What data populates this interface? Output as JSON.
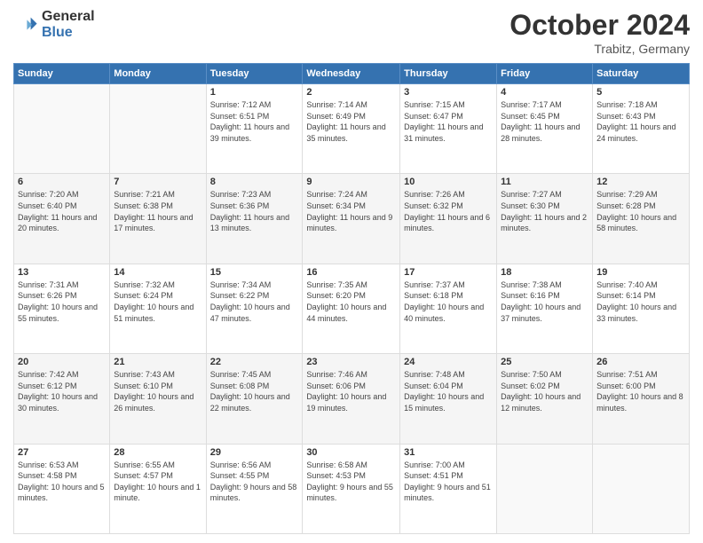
{
  "logo": {
    "line1": "General",
    "line2": "Blue"
  },
  "title": "October 2024",
  "subtitle": "Trabitz, Germany",
  "weekdays": [
    "Sunday",
    "Monday",
    "Tuesday",
    "Wednesday",
    "Thursday",
    "Friday",
    "Saturday"
  ],
  "weeks": [
    [
      {
        "day": "",
        "info": ""
      },
      {
        "day": "",
        "info": ""
      },
      {
        "day": "1",
        "info": "Sunrise: 7:12 AM\nSunset: 6:51 PM\nDaylight: 11 hours and 39 minutes."
      },
      {
        "day": "2",
        "info": "Sunrise: 7:14 AM\nSunset: 6:49 PM\nDaylight: 11 hours and 35 minutes."
      },
      {
        "day": "3",
        "info": "Sunrise: 7:15 AM\nSunset: 6:47 PM\nDaylight: 11 hours and 31 minutes."
      },
      {
        "day": "4",
        "info": "Sunrise: 7:17 AM\nSunset: 6:45 PM\nDaylight: 11 hours and 28 minutes."
      },
      {
        "day": "5",
        "info": "Sunrise: 7:18 AM\nSunset: 6:43 PM\nDaylight: 11 hours and 24 minutes."
      }
    ],
    [
      {
        "day": "6",
        "info": "Sunrise: 7:20 AM\nSunset: 6:40 PM\nDaylight: 11 hours and 20 minutes."
      },
      {
        "day": "7",
        "info": "Sunrise: 7:21 AM\nSunset: 6:38 PM\nDaylight: 11 hours and 17 minutes."
      },
      {
        "day": "8",
        "info": "Sunrise: 7:23 AM\nSunset: 6:36 PM\nDaylight: 11 hours and 13 minutes."
      },
      {
        "day": "9",
        "info": "Sunrise: 7:24 AM\nSunset: 6:34 PM\nDaylight: 11 hours and 9 minutes."
      },
      {
        "day": "10",
        "info": "Sunrise: 7:26 AM\nSunset: 6:32 PM\nDaylight: 11 hours and 6 minutes."
      },
      {
        "day": "11",
        "info": "Sunrise: 7:27 AM\nSunset: 6:30 PM\nDaylight: 11 hours and 2 minutes."
      },
      {
        "day": "12",
        "info": "Sunrise: 7:29 AM\nSunset: 6:28 PM\nDaylight: 10 hours and 58 minutes."
      }
    ],
    [
      {
        "day": "13",
        "info": "Sunrise: 7:31 AM\nSunset: 6:26 PM\nDaylight: 10 hours and 55 minutes."
      },
      {
        "day": "14",
        "info": "Sunrise: 7:32 AM\nSunset: 6:24 PM\nDaylight: 10 hours and 51 minutes."
      },
      {
        "day": "15",
        "info": "Sunrise: 7:34 AM\nSunset: 6:22 PM\nDaylight: 10 hours and 47 minutes."
      },
      {
        "day": "16",
        "info": "Sunrise: 7:35 AM\nSunset: 6:20 PM\nDaylight: 10 hours and 44 minutes."
      },
      {
        "day": "17",
        "info": "Sunrise: 7:37 AM\nSunset: 6:18 PM\nDaylight: 10 hours and 40 minutes."
      },
      {
        "day": "18",
        "info": "Sunrise: 7:38 AM\nSunset: 6:16 PM\nDaylight: 10 hours and 37 minutes."
      },
      {
        "day": "19",
        "info": "Sunrise: 7:40 AM\nSunset: 6:14 PM\nDaylight: 10 hours and 33 minutes."
      }
    ],
    [
      {
        "day": "20",
        "info": "Sunrise: 7:42 AM\nSunset: 6:12 PM\nDaylight: 10 hours and 30 minutes."
      },
      {
        "day": "21",
        "info": "Sunrise: 7:43 AM\nSunset: 6:10 PM\nDaylight: 10 hours and 26 minutes."
      },
      {
        "day": "22",
        "info": "Sunrise: 7:45 AM\nSunset: 6:08 PM\nDaylight: 10 hours and 22 minutes."
      },
      {
        "day": "23",
        "info": "Sunrise: 7:46 AM\nSunset: 6:06 PM\nDaylight: 10 hours and 19 minutes."
      },
      {
        "day": "24",
        "info": "Sunrise: 7:48 AM\nSunset: 6:04 PM\nDaylight: 10 hours and 15 minutes."
      },
      {
        "day": "25",
        "info": "Sunrise: 7:50 AM\nSunset: 6:02 PM\nDaylight: 10 hours and 12 minutes."
      },
      {
        "day": "26",
        "info": "Sunrise: 7:51 AM\nSunset: 6:00 PM\nDaylight: 10 hours and 8 minutes."
      }
    ],
    [
      {
        "day": "27",
        "info": "Sunrise: 6:53 AM\nSunset: 4:58 PM\nDaylight: 10 hours and 5 minutes."
      },
      {
        "day": "28",
        "info": "Sunrise: 6:55 AM\nSunset: 4:57 PM\nDaylight: 10 hours and 1 minute."
      },
      {
        "day": "29",
        "info": "Sunrise: 6:56 AM\nSunset: 4:55 PM\nDaylight: 9 hours and 58 minutes."
      },
      {
        "day": "30",
        "info": "Sunrise: 6:58 AM\nSunset: 4:53 PM\nDaylight: 9 hours and 55 minutes."
      },
      {
        "day": "31",
        "info": "Sunrise: 7:00 AM\nSunset: 4:51 PM\nDaylight: 9 hours and 51 minutes."
      },
      {
        "day": "",
        "info": ""
      },
      {
        "day": "",
        "info": ""
      }
    ]
  ]
}
